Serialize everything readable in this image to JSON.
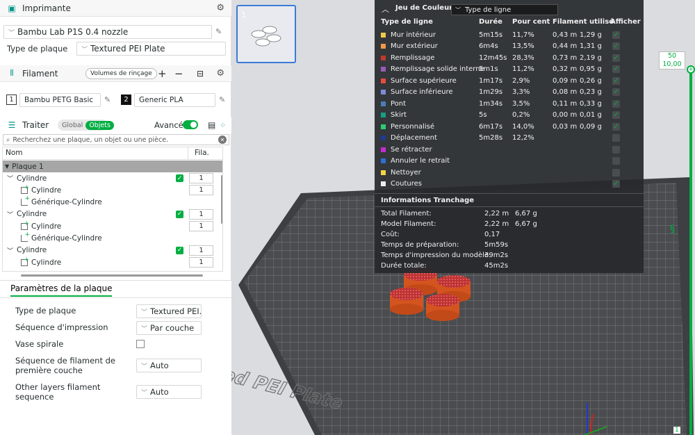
{
  "printer": {
    "section_title": "Imprimante",
    "name": "Bambu Lab P1S 0.4 nozzle",
    "plate_label": "Type de plaque",
    "plate_value": "Textured PEI Plate"
  },
  "filament": {
    "section_title": "Filament",
    "flush_button": "Volumes de rinçage",
    "slots": [
      {
        "num": "1",
        "name": "Bambu PETG Basic"
      },
      {
        "num": "2",
        "name": "Generic PLA"
      }
    ]
  },
  "process": {
    "section_title": "Traiter",
    "toggle_global": "Global",
    "toggle_objects": "Objets",
    "advanced_label": "Avancé",
    "search_placeholder": "Recherchez une plaque, un objet ou une pièce."
  },
  "tree": {
    "col_name": "Nom",
    "col_fila": "Fila.",
    "plate_row": "Plaque 1",
    "rows": [
      {
        "kind": "object",
        "label": "Cylindre",
        "fila": "1"
      },
      {
        "kind": "part",
        "label": "Cylindre",
        "fila": "1"
      },
      {
        "kind": "modifier",
        "label": "Générique-Cylindre"
      },
      {
        "kind": "object",
        "label": "Cylindre",
        "fila": "1"
      },
      {
        "kind": "part",
        "label": "Cylindre",
        "fila": "1"
      },
      {
        "kind": "modifier",
        "label": "Générique-Cylindre"
      },
      {
        "kind": "object",
        "label": "Cylindre",
        "fila": "1"
      },
      {
        "kind": "part",
        "label": "Cylindre",
        "fila": "1"
      }
    ]
  },
  "plate_params": {
    "tab_title": "Paramètres de la plaque",
    "items": [
      {
        "label": "Type de plaque",
        "value": "Textured PEI..."
      },
      {
        "label": "Séquence d'impression",
        "value": "Par couche"
      },
      {
        "label": "Vase spirale",
        "value": ""
      },
      {
        "label": "Séquence de filament de première couche",
        "value": "Auto"
      },
      {
        "label": "Other layers filament sequence",
        "value": "Auto"
      }
    ]
  },
  "thumbnail": {
    "number": "1"
  },
  "legend": {
    "title": "Jeu de Couleur",
    "mode": "Type de ligne",
    "headers": [
      "Type de ligne",
      "Durée",
      "Pour cent",
      "Filament utilisé",
      "Afficher"
    ],
    "rows": [
      {
        "name": "Mur intérieur",
        "color": "#f2c94c",
        "time": "5m15s",
        "pct": "11,7%",
        "m": "0,43 m",
        "g": "1,29 g",
        "show": true
      },
      {
        "name": "Mur extérieur",
        "color": "#f2994a",
        "time": "6m4s",
        "pct": "13,5%",
        "m": "0,44 m",
        "g": "1,31 g",
        "show": true
      },
      {
        "name": "Remplissage",
        "color": "#c0392b",
        "time": "12m45s",
        "pct": "28,3%",
        "m": "0,73 m",
        "g": "2,19 g",
        "show": true
      },
      {
        "name": "Remplissage solide interne",
        "color": "#9b59b6",
        "time": "5m1s",
        "pct": "11,2%",
        "m": "0,32 m",
        "g": "0,95 g",
        "show": true
      },
      {
        "name": "Surface supérieure",
        "color": "#e74c3c",
        "time": "1m17s",
        "pct": "2,9%",
        "m": "0,09 m",
        "g": "0,26 g",
        "show": true
      },
      {
        "name": "Surface inférieure",
        "color": "#7b8cde",
        "time": "1m29s",
        "pct": "3,3%",
        "m": "0,08 m",
        "g": "0,23 g",
        "show": true
      },
      {
        "name": "Pont",
        "color": "#4a7fb5",
        "time": "1m34s",
        "pct": "3,5%",
        "m": "0,11 m",
        "g": "0,33 g",
        "show": true
      },
      {
        "name": "Skirt",
        "color": "#14a085",
        "time": "5s",
        "pct": "0,2%",
        "m": "0,00 m",
        "g": "0,01 g",
        "show": true
      },
      {
        "name": "Personnalisé",
        "color": "#2ecc71",
        "time": "6m17s",
        "pct": "14,0%",
        "m": "0,03 m",
        "g": "0,09 g",
        "show": true
      },
      {
        "name": "Déplacement",
        "color": "#1f3a93",
        "time": "5m28s",
        "pct": "12,2%",
        "m": "",
        "g": "",
        "show": false
      },
      {
        "name": "Se rétracter",
        "color": "#c42cd1",
        "time": "",
        "pct": "",
        "m": "",
        "g": "",
        "show": false
      },
      {
        "name": "Annuler le retrait",
        "color": "#2d6fd1",
        "time": "",
        "pct": "",
        "m": "",
        "g": "",
        "show": false
      },
      {
        "name": "Nettoyer",
        "color": "#f5d547",
        "time": "",
        "pct": "",
        "m": "",
        "g": "",
        "show": false
      },
      {
        "name": "Coutures",
        "color": "#eeeeee",
        "time": "",
        "pct": "",
        "m": "",
        "g": "",
        "show": true
      }
    ],
    "info_title": "Informations Tranchage",
    "info": [
      {
        "label": "Total Filament:",
        "v1": "2,22 m",
        "v2": "6,67 g"
      },
      {
        "label": "Model Filament:",
        "v1": "2,22 m",
        "v2": "6,67 g"
      },
      {
        "label": "Coût:",
        "v1": "0,17",
        "v2": ""
      },
      {
        "label": "Temps de préparation:",
        "v1": "5m59s",
        "v2": ""
      },
      {
        "label": "Temps d'impression du modèle:",
        "v1": "39m2s",
        "v2": ""
      },
      {
        "label": "Durée totale:",
        "v1": "45m2s",
        "v2": ""
      }
    ]
  },
  "plate_text": "Textured PEI Plate",
  "layer_slider": {
    "top_layer": "50",
    "top_height": "10,00",
    "bottom_layer": "1"
  }
}
